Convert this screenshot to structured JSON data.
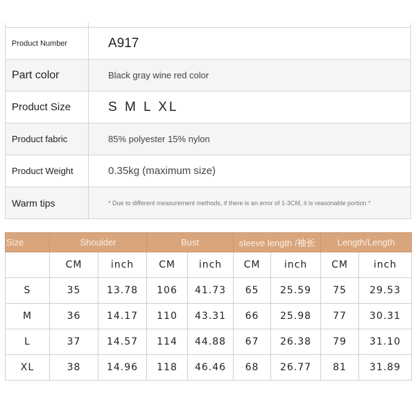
{
  "spec": [
    {
      "label": "Product Number",
      "value": "A917",
      "label_size": 11,
      "value_size": 19
    },
    {
      "label": "Part color",
      "value": "Black gray wine red color",
      "label_size": 16,
      "value_size": 13
    },
    {
      "label": "Product Size",
      "value": "S M L XL",
      "label_size": 15,
      "value_size": 19
    },
    {
      "label": "Product fabric",
      "value": "85% polyester 15% nylon",
      "label_size": 13,
      "value_size": 13
    },
    {
      "label": "Product Weight",
      "value": "0.35kg (maximum size)",
      "label_size": 13,
      "value_size": 15
    },
    {
      "label": "Warm tips",
      "value": "* Due to different measurement methods, if there is an error of 1-3CM, it is reasonable portion *",
      "label_size": 14,
      "value_size": 9
    }
  ],
  "size_table": {
    "header_color": "#d9a57c",
    "headers": [
      "Size",
      "Shoulder",
      "Bust",
      "sleeve length /袖长",
      "Length/Length"
    ],
    "units": [
      "CM",
      "inch",
      "CM",
      "inch",
      "CM",
      "inch",
      "CM",
      "inch"
    ],
    "rows": [
      [
        "S",
        "35",
        "13.78",
        "106",
        "41.73",
        "65",
        "25.59",
        "75",
        "29.53"
      ],
      [
        "M",
        "36",
        "14.17",
        "110",
        "43.31",
        "66",
        "25.98",
        "77",
        "30.31"
      ],
      [
        "L",
        "37",
        "14.57",
        "114",
        "44.88",
        "67",
        "26.38",
        "79",
        "31.10"
      ],
      [
        "XL",
        "38",
        "14.96",
        "118",
        "46.46",
        "68",
        "26.77",
        "81",
        "31.89"
      ]
    ]
  }
}
